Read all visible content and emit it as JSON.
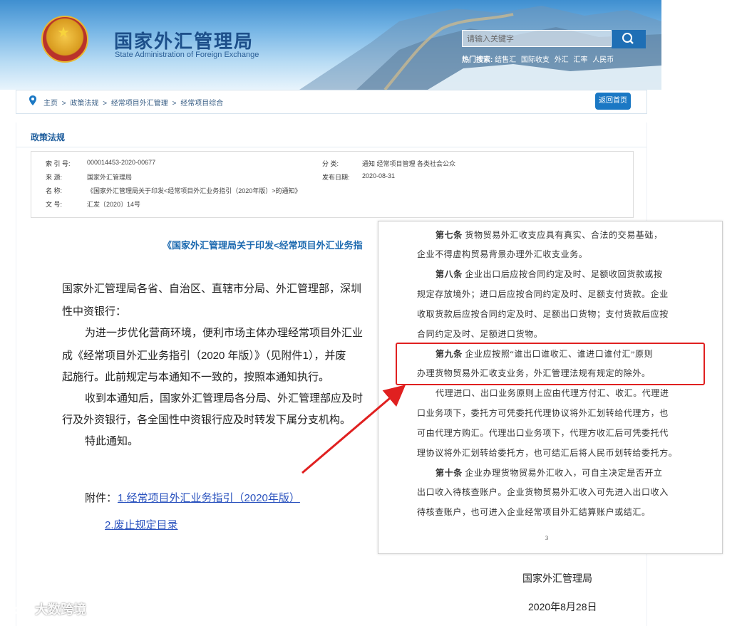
{
  "header": {
    "title_cn": "国家外汇管理局",
    "title_en": "State Administration of Foreign Exchange",
    "search_placeholder": "请输入关键字",
    "hot_label": "热门搜索:",
    "hot_items": [
      "结售汇",
      "国际收支",
      "外汇",
      "汇率",
      "人民币"
    ]
  },
  "breadcrumb": {
    "items": [
      "主页",
      "政策法规",
      "经常项目外汇管理",
      "经常项目综合"
    ],
    "separator": ">",
    "home_button": "返回首页"
  },
  "panel": {
    "title": "政策法规",
    "meta": {
      "index_key": "索  引  号:",
      "index_val": "000014453-2020-00677",
      "source_key": "来      源:",
      "source_val": "国家外汇管理局",
      "name_key": "名      称:",
      "name_val": "《国家外汇管理局关于印发<经常项目外汇业务指引（2020年版）>的通知》",
      "docno_key": "文      号:",
      "docno_val": "汇发〔2020〕14号",
      "category_key": "分      类:",
      "category_val": "通知  经常项目管理  各类社会公众",
      "date_key": "发布日期:",
      "date_val": "2020-08-31"
    }
  },
  "document": {
    "title": "《国家外汇管理局关于印发<经常项目外汇业务指",
    "lines": [
      "国家外汇管理局各省、自治区、直辖市分局、外汇管理部，深圳",
      "性中资银行：",
      "为进一步优化营商环境，便利市场主体办理经常项目外汇业",
      "成《经常项目外汇业务指引（2020 年版）》（见附件1），并废",
      "起施行。此前规定与本通知不一致的，按照本通知执行。",
      "收到本通知后，国家外汇管理局各分局、外汇管理部应及时",
      "行及外资银行，各全国性中资银行应及时转发下属分支机构。",
      "特此通知。"
    ],
    "attachment_label": "附件：",
    "attachments": [
      "1.经常项目外汇业务指引（2020年版）",
      "2.废止规定目录"
    ],
    "signature": "国家外汇管理局",
    "sign_date": "2020年8月28日"
  },
  "overlay": {
    "lines": [
      {
        "bold": "第七条",
        "text": " 货物贸易外汇收支应具有真实、合法的交易基础，"
      },
      {
        "bold": "",
        "text": "企业不得虚构贸易背景办理外汇收支业务。"
      },
      {
        "bold": "第八条",
        "text": " 企业出口后应按合同约定及时、足额收回货款或按"
      },
      {
        "bold": "",
        "text": "规定存放境外；进口后应按合同约定及时、足额支付货款。企业"
      },
      {
        "bold": "",
        "text": "收取货款后应按合同约定及时、足额出口货物；支付货款后应按"
      },
      {
        "bold": "",
        "text": "合同约定及时、足额进口货物。"
      },
      {
        "bold": "第九条",
        "text": " 企业应按照“谁出口谁收汇、谁进口谁付汇”原则"
      },
      {
        "bold": "",
        "text": "办理货物贸易外汇收支业务，外汇管理法规有规定的除外。"
      },
      {
        "bold": "",
        "text": "代理进口、出口业务原则上应由代理方付汇、收汇。代理进"
      },
      {
        "bold": "",
        "text": "口业务项下，委托方可凭委托代理协议将外汇划转给代理方，也"
      },
      {
        "bold": "",
        "text": "可由代理方购汇。代理出口业务项下，代理方收汇后可凭委托代"
      },
      {
        "bold": "",
        "text": "理协议将外汇划转给委托方，也可结汇后将人民币划转给委托方。"
      },
      {
        "bold": "第十条",
        "text": " 企业办理货物贸易外汇收入，可自主决定是否开立"
      },
      {
        "bold": "",
        "text": "出口收入待核查账户。企业货物贸易外汇收入可先进入出口收入"
      },
      {
        "bold": "",
        "text": "待核查账户，也可进入企业经常项目外汇结算账户或结汇。"
      }
    ],
    "page_number": "3"
  },
  "watermark": "大数跨境",
  "colors": {
    "link": "#2a52be",
    "title_blue": "#1d6ab0",
    "highlight": "#e02020",
    "button": "#1b78c4"
  }
}
